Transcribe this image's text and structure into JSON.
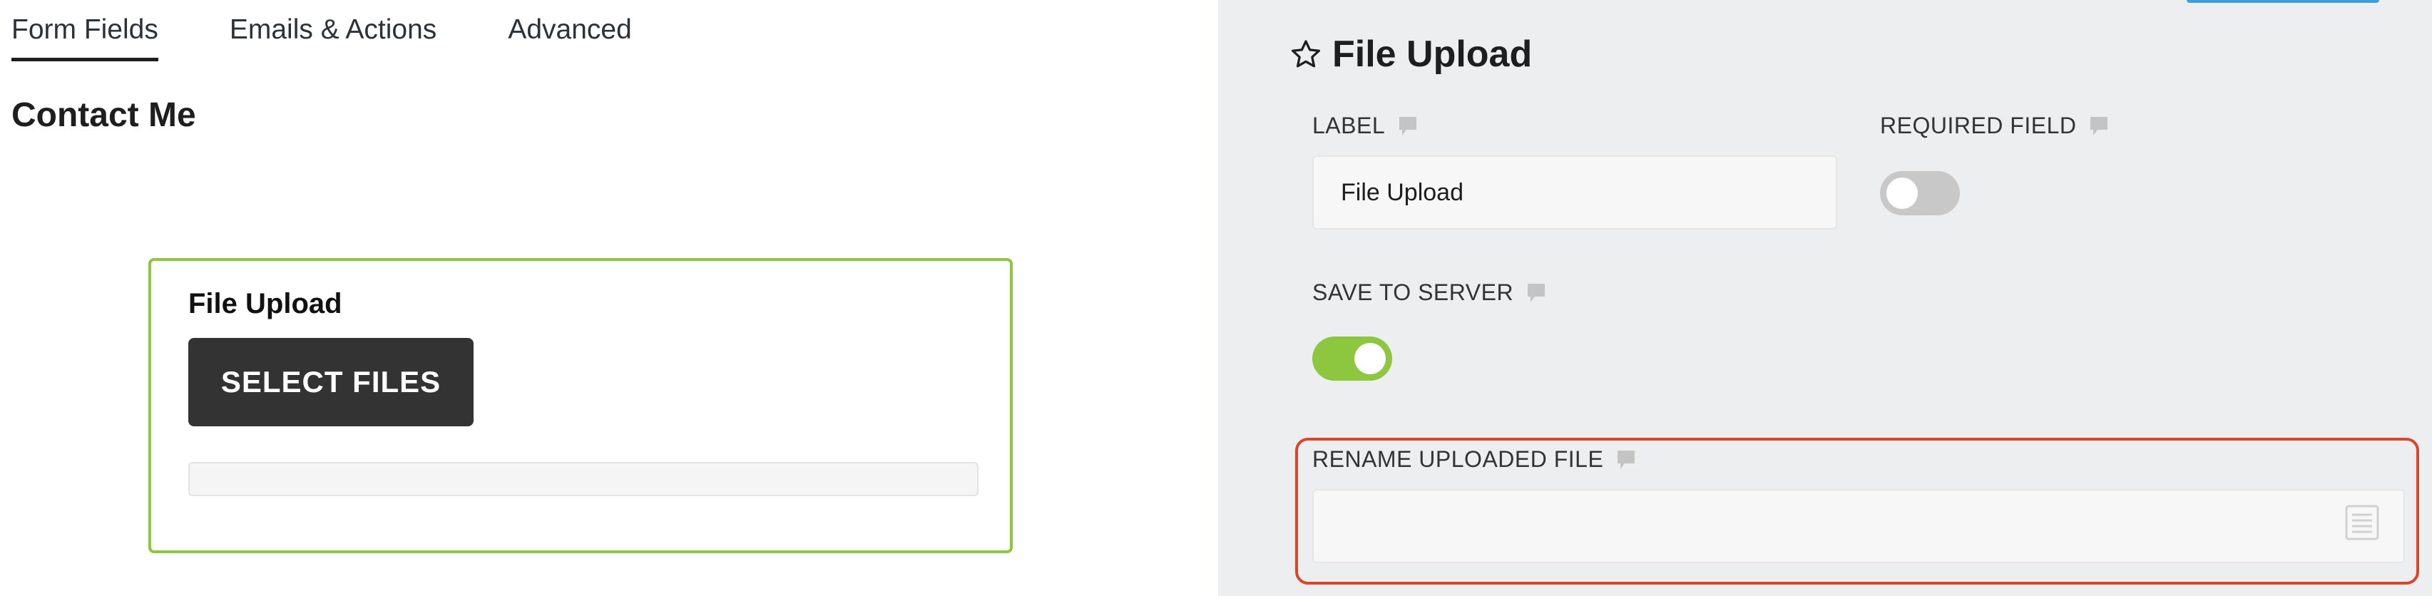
{
  "tabs": [
    {
      "label": "Form Fields",
      "active": true
    },
    {
      "label": "Emails & Actions",
      "active": false
    },
    {
      "label": "Advanced",
      "active": false
    }
  ],
  "form": {
    "title": "Contact Me",
    "field": {
      "label": "File Upload",
      "button_label": "SELECT FILES",
      "progress": 0
    }
  },
  "settings_panel": {
    "title": "File Upload",
    "label_setting": {
      "label": "LABEL",
      "value": "File Upload"
    },
    "required_setting": {
      "label": "REQUIRED FIELD",
      "enabled": false
    },
    "save_to_server_setting": {
      "label": "SAVE TO SERVER",
      "enabled": true
    },
    "rename_setting": {
      "label": "RENAME UPLOADED FILE",
      "value": ""
    }
  },
  "colors": {
    "accent_green": "#8dc63f",
    "button_dark": "#333333",
    "highlight_red": "#d9472b",
    "panel_bg": "#edeef0",
    "top_button_blue": "#3a9ed9"
  },
  "icons": [
    "star-icon",
    "help-icon",
    "merge-tag-icon"
  ]
}
